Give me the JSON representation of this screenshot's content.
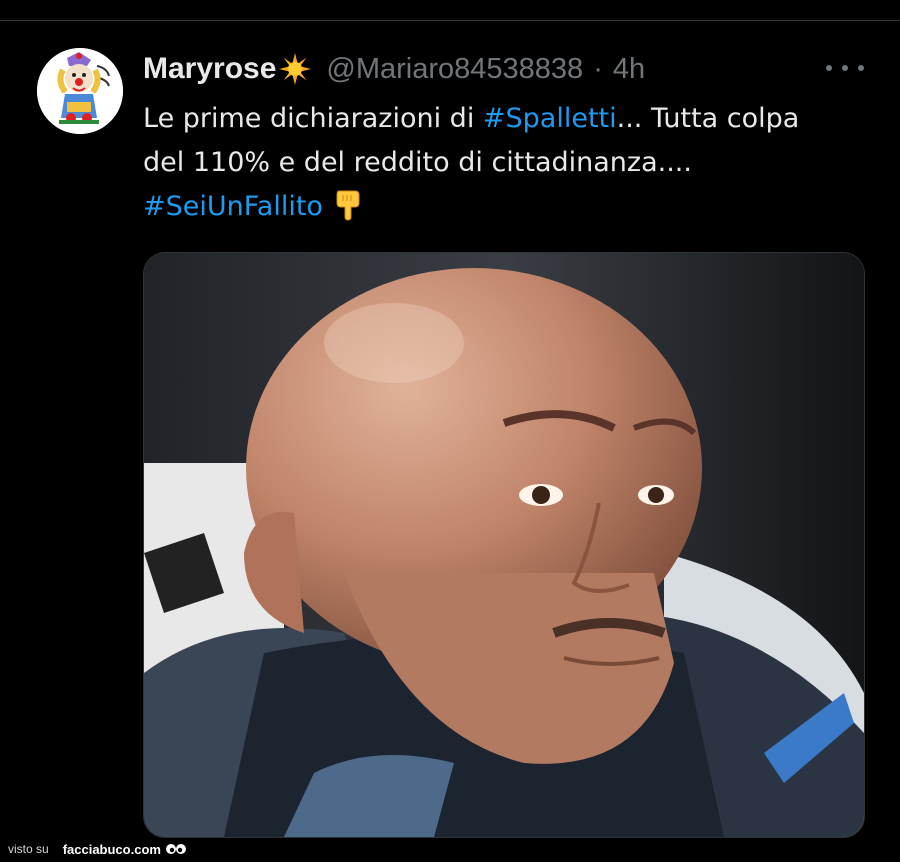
{
  "tweet": {
    "author_name": "Maryrose",
    "author_handle": "@Mariaro84538838",
    "separator": "·",
    "time": "4h",
    "text_lines": {
      "line1_pre": "Le prime dichiarazioni di ",
      "hashtag1": "#Spalletti",
      "line1_post": "... Tutta colpa",
      "line2": "del 110% e del reddito di cittadinanza....",
      "hashtag2": "#SeiUnFallito"
    },
    "emoji": {
      "name_badge": "sun-emoji",
      "text_end": "pointing-down-hand-emoji"
    },
    "avatar": "cartoon-clown-avatar",
    "media": "photo-bald-man-portrait"
  },
  "footer": {
    "visto_su": "visto su",
    "site": "facciabuco.com"
  },
  "colors": {
    "background": "#000000",
    "text": "#e7e9ea",
    "muted": "#71767b",
    "hashtag": "#1d9bf0"
  }
}
